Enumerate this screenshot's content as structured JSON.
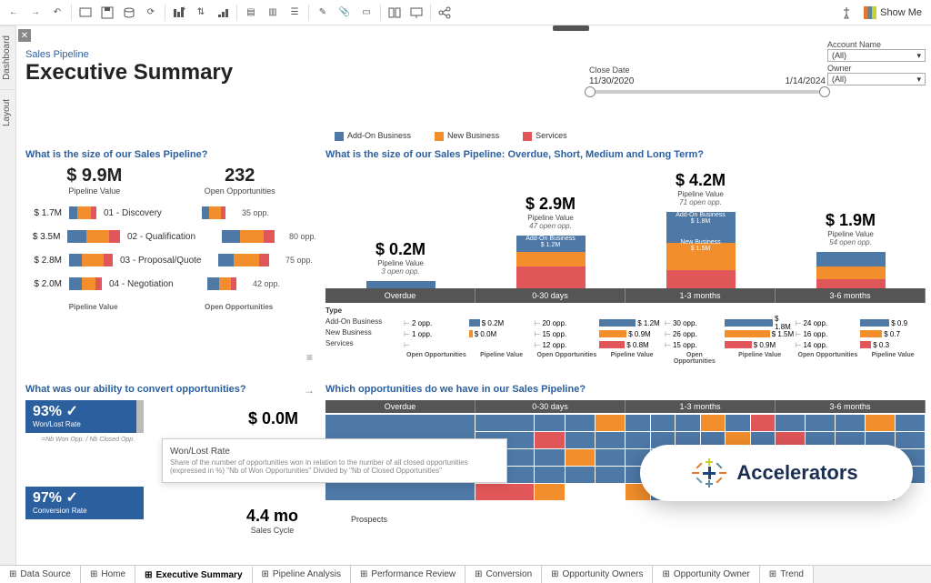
{
  "header": {
    "subtitle": "Sales Pipeline",
    "title": "Executive Summary",
    "show_me": "Show Me"
  },
  "filters": {
    "account_label": "Account Name",
    "account_value": "(All)",
    "owner_label": "Owner",
    "owner_value": "(All)",
    "close_date_label": "Close Date",
    "close_date_start": "11/30/2020",
    "close_date_end": "1/14/2024"
  },
  "legend": {
    "addon": "Add-On Business",
    "newbiz": "New Business",
    "services": "Services"
  },
  "cardA": {
    "title": "What is the size of our Sales Pipeline?",
    "pipeline_value": "$ 9.9M",
    "pipeline_value_lbl": "Pipeline Value",
    "open_opps": "232",
    "open_opps_lbl": "Open Opportunities",
    "stages": [
      {
        "val": "$ 1.7M",
        "name": "01 - Discovery",
        "opp": "35 opp."
      },
      {
        "val": "$ 3.5M",
        "name": "02 - Qualification",
        "opp": "80 opp."
      },
      {
        "val": "$ 2.8M",
        "name": "03 - Proposal/Quote",
        "opp": "75 opp."
      },
      {
        "val": "$ 2.0M",
        "name": "04 - Negotiation",
        "opp": "42 opp."
      }
    ],
    "foot_left": "Pipeline Value",
    "foot_right": "Open Opportunities"
  },
  "cardB": {
    "title": "What is the size of our Sales Pipeline: Overdue, Short, Medium and Long Term?",
    "cols": [
      {
        "pv": "$ 0.2M",
        "opps": "3 open opp.",
        "hdr": "Overdue"
      },
      {
        "pv": "$ 2.9M",
        "opps": "47 open opp.",
        "hdr": "0-30 days",
        "top": "Add-On Business",
        "top_val": "$ 1.2M"
      },
      {
        "pv": "$ 4.2M",
        "opps": "71 open opp.",
        "hdr": "1-3 months",
        "top": "Add-On Business",
        "top_val": "$ 1.8M",
        "mid": "New Business",
        "mid_val": "$ 1.5M"
      },
      {
        "pv": "$ 1.9M",
        "opps": "54 open opp.",
        "hdr": "3-6 months"
      }
    ],
    "pvlbl": "Pipeline Value",
    "type_hdr": "Type",
    "rows": [
      "Add-On Business",
      "New Business",
      "Services"
    ],
    "cells": [
      [
        [
          "2 opp.",
          "$ 0.2M"
        ],
        [
          "1 opp.",
          "$ 0.0M"
        ],
        [
          "",
          ""
        ]
      ],
      [
        [
          "20 opp.",
          "$ 1.2M"
        ],
        [
          "15 opp.",
          "$ 0.9M"
        ],
        [
          "12 opp.",
          "$ 0.8M"
        ]
      ],
      [
        [
          "30 opp.",
          "$ 1.8M"
        ],
        [
          "26 opp.",
          "$ 1.5M"
        ],
        [
          "15 opp.",
          "$ 0.9M"
        ]
      ],
      [
        [
          "24 opp.",
          "$ 0.9"
        ],
        [
          "16 opp.",
          "$ 0.7"
        ],
        [
          "14 opp.",
          "$ 0.3"
        ]
      ]
    ],
    "foot_left": "Open Opportunities",
    "foot_right": "Pipeline Value"
  },
  "cardC": {
    "title": "What was our ability to convert opportunities?",
    "rate1_val": "93% ✓",
    "rate1_lbl": "Won/Lost Rate",
    "note": "=Nb Won Opp. / Nb Closed Opp.",
    "rate2_val": "97% ✓",
    "rate2_lbl": "Conversion Rate",
    "val1": "$ 0.0M",
    "val2": "4.4 mo",
    "val2_lbl": "Sales Cycle"
  },
  "cardD": {
    "title": "Which opportunities do we have in our Sales Pipeline?",
    "hdrs": [
      "Overdue",
      "0-30 days",
      "1-3 months",
      "3-6 months"
    ],
    "prospects": "Prospects"
  },
  "tooltip": {
    "title": "Won/Lost Rate",
    "body": "Share of the number of opportunities won in relation to the number of all closed opportunities (expressed in %)  \"Nb of Won Opportunities\" Divided by \"Nb of Closed Opportunities\""
  },
  "accel": "Accelerators",
  "tabs": {
    "data_source": "Data Source",
    "items": [
      "Home",
      "Executive Summary",
      "Pipeline Analysis",
      "Performance Review",
      "Conversion",
      "Opportunity Owners",
      "Opportunity Owner",
      "Trend"
    ],
    "active": "Executive Summary"
  },
  "chart_data": {
    "pipeline_by_stage": {
      "type": "bar",
      "categories": [
        "01 - Discovery",
        "02 - Qualification",
        "03 - Proposal/Quote",
        "04 - Negotiation"
      ],
      "series": [
        {
          "name": "Pipeline Value ($M)",
          "values": [
            1.7,
            3.5,
            2.8,
            2.0
          ]
        },
        {
          "name": "Open Opportunities",
          "values": [
            35,
            80,
            75,
            42
          ]
        }
      ]
    },
    "pipeline_by_term": {
      "type": "bar",
      "categories": [
        "Overdue",
        "0-30 days",
        "1-3 months",
        "3-6 months"
      ],
      "series": [
        {
          "name": "Pipeline Value ($M)",
          "values": [
            0.2,
            2.9,
            4.2,
            1.9
          ]
        },
        {
          "name": "Open Opportunities",
          "values": [
            3,
            47,
            71,
            54
          ]
        }
      ]
    },
    "type_by_term": {
      "type": "table",
      "rows": [
        "Add-On Business",
        "New Business",
        "Services"
      ],
      "columns": [
        "Overdue",
        "0-30 days",
        "1-3 months",
        "3-6 months"
      ],
      "open_opps": [
        [
          2,
          20,
          30,
          24
        ],
        [
          1,
          15,
          26,
          16
        ],
        [
          0,
          12,
          15,
          14
        ]
      ],
      "pipeline_value_m": [
        [
          0.2,
          1.2,
          1.8,
          0.9
        ],
        [
          0.0,
          0.9,
          1.5,
          0.7
        ],
        [
          0.0,
          0.8,
          0.9,
          0.3
        ]
      ]
    },
    "kpis": {
      "pipeline_value_m": 9.9,
      "open_opps": 232,
      "won_lost_rate": 0.93,
      "conversion_rate": 0.97,
      "sales_cycle_months": 4.4
    }
  }
}
